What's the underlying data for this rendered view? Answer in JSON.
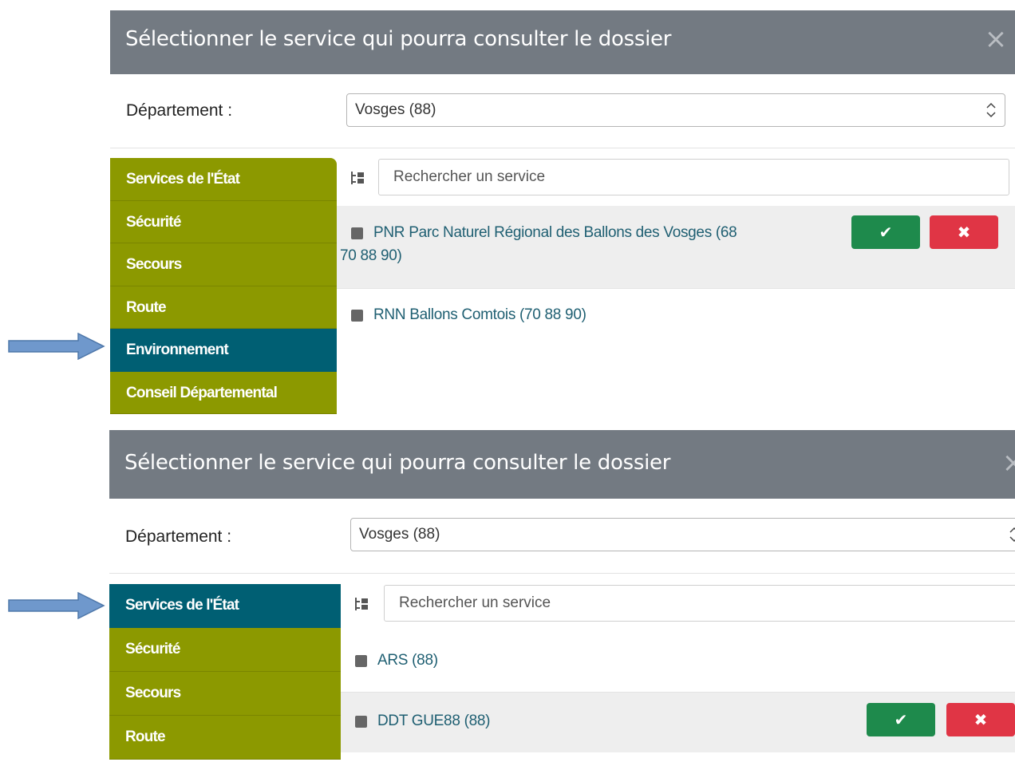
{
  "dialog_title": "Sélectionner le service qui pourra consulter le dossier",
  "close_glyph": "×",
  "department_label": "Département :",
  "department_value": "Vosges (88)",
  "search_placeholder": "Rechercher un service",
  "confirm_glyph": "✔",
  "cancel_glyph": "✖",
  "colors": {
    "header": "#737a82",
    "sidebar": "#8c9900",
    "sidebar_active": "#005f73",
    "link": "#1f5f72",
    "confirm": "#1e8a4c",
    "cancel": "#e03545",
    "arrow": "#6f98cc"
  },
  "panel1": {
    "sidebar": [
      {
        "label": "Services de l'État",
        "active": false
      },
      {
        "label": "Sécurité",
        "active": false
      },
      {
        "label": "Secours",
        "active": false
      },
      {
        "label": "Route",
        "active": false
      },
      {
        "label": "Environnement",
        "active": true
      },
      {
        "label": "Conseil Départemental",
        "active": false
      }
    ],
    "services": [
      {
        "label": "PNR Parc Naturel Régional des Ballons des Vosges (68 70 88 90)",
        "hover": true
      },
      {
        "label": "RNN Ballons Comtois (70 88 90)",
        "hover": false
      }
    ]
  },
  "panel2": {
    "sidebar": [
      {
        "label": "Services de l'État",
        "active": true
      },
      {
        "label": "Sécurité",
        "active": false
      },
      {
        "label": "Secours",
        "active": false
      },
      {
        "label": "Route",
        "active": false
      }
    ],
    "services": [
      {
        "label": "ARS (88)",
        "hover": false
      },
      {
        "label": "DDT GUE88 (88)",
        "hover": true
      }
    ]
  }
}
